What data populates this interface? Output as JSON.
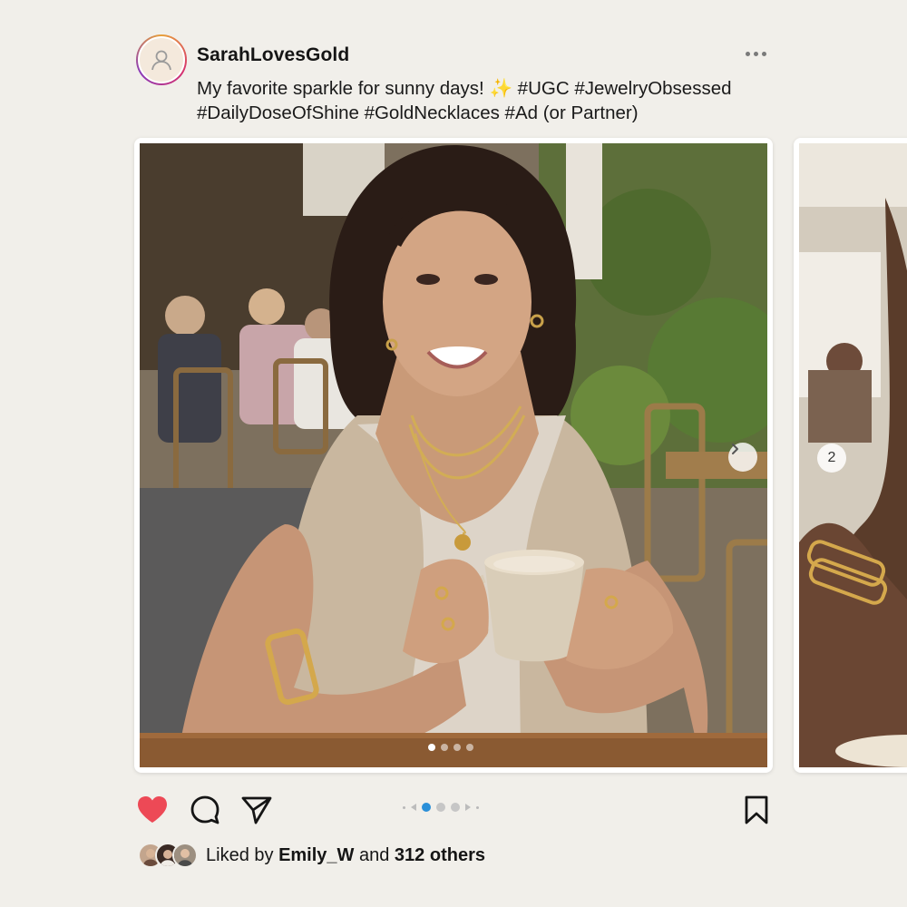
{
  "post": {
    "username": "SarahLovesGold",
    "caption_line1": "My favorite sparkle for sunny days! ",
    "sparkle": "✨",
    "caption_line1_tags": " #UGC #JewelryObsessed",
    "caption_line2": "#DailyDoseOfShine #GoldNecklaces #Ad (or Partner)",
    "more_icon": "more-horizontal-icon",
    "avatar_icon": "user-icon"
  },
  "carousel": {
    "current_slide": 1,
    "total_slides": 4,
    "next_slide_number": "2",
    "next_icon": "chevron-right-icon"
  },
  "actions": {
    "like_icon": "heart-icon",
    "comment_icon": "comment-icon",
    "share_icon": "send-icon",
    "save_icon": "bookmark-icon",
    "like_color": "#ed4956",
    "pager_active_color": "#2a8fd8"
  },
  "likes": {
    "prefix": "Liked by",
    "user": "Emily_W",
    "connector": "and",
    "others": "312 others"
  }
}
